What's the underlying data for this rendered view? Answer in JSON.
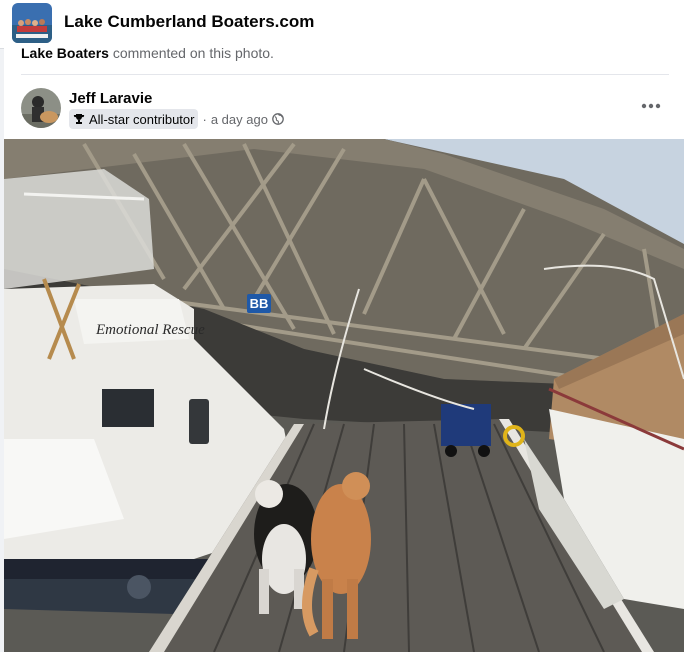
{
  "group": {
    "title": "Lake Cumberland Boaters.com"
  },
  "activity": {
    "actor": "Lake Boaters",
    "text": "commented on this photo."
  },
  "post": {
    "author": "Jeff Laravie",
    "badge": "All-star contributor",
    "separator": "·",
    "time": "a day ago",
    "privacy_icon": "globe-icon",
    "more_icon": "more-horizontal-icon"
  },
  "photo": {
    "dock_sign": "BB",
    "boat_name": "Emotional Rescue"
  },
  "colors": {
    "accent": "#1877f2",
    "text": "#050505",
    "secondary": "#65676b"
  }
}
